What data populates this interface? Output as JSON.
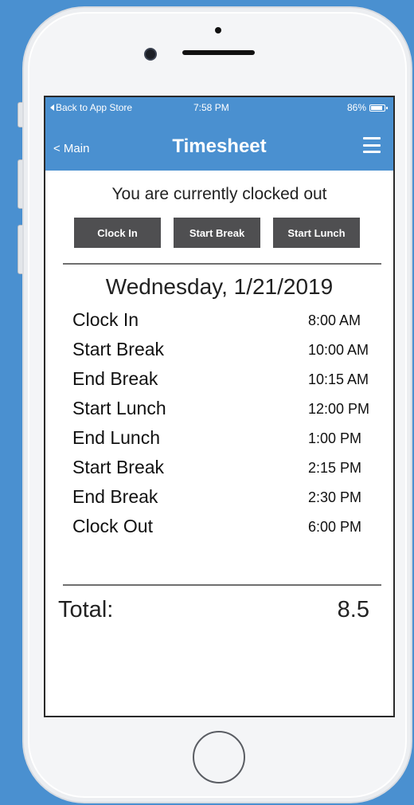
{
  "status_bar": {
    "back_label": "Back to App Store",
    "time": "7:58 PM",
    "battery_percent": "86%",
    "battery_level": 0.86
  },
  "nav": {
    "back_label": "< Main",
    "title": "Timesheet",
    "menu_icon": "hamburger-menu-icon"
  },
  "clock_state": "You are currently clocked out",
  "actions": {
    "clock_in": "Clock In",
    "start_break": "Start Break",
    "start_lunch": "Start Lunch"
  },
  "day": {
    "date": "Wednesday, 1/21/2019",
    "entries": [
      {
        "label": "Clock In",
        "time": "8:00 AM"
      },
      {
        "label": "Start Break",
        "time": "10:00 AM"
      },
      {
        "label": "End Break",
        "time": "10:15 AM"
      },
      {
        "label": "Start Lunch",
        "time": "12:00 PM"
      },
      {
        "label": "End Lunch",
        "time": "1:00 PM"
      },
      {
        "label": "Start Break",
        "time": "2:15 PM"
      },
      {
        "label": "End Break",
        "time": "2:30 PM"
      },
      {
        "label": "Clock Out",
        "time": "6:00 PM"
      }
    ]
  },
  "total": {
    "label": "Total:",
    "value": "8.5"
  },
  "colors": {
    "background": "#4a90d0",
    "app_bar": "#4a90d0",
    "button": "#4f4f51"
  }
}
